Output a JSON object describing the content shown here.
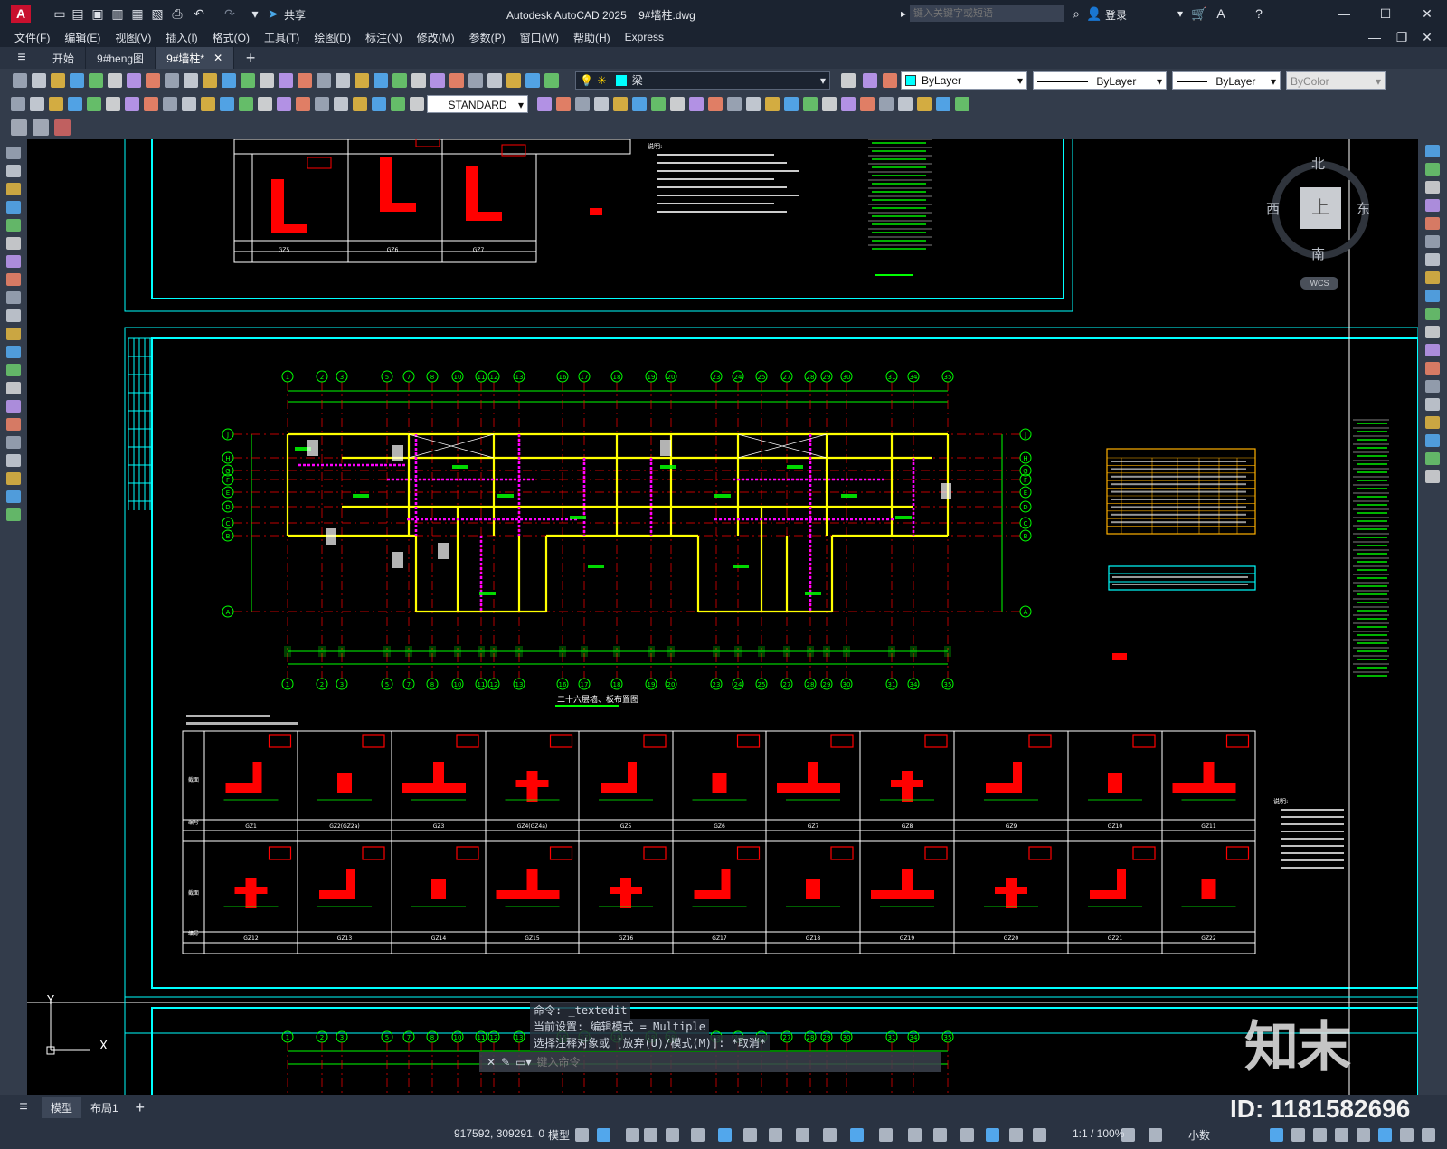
{
  "app": {
    "logo": "A",
    "title": "Autodesk AutoCAD 2025",
    "filename": "9#墙柱.dwg",
    "search_placeholder": "键入关键字或短语",
    "login": "登录",
    "share": "共享"
  },
  "menu": [
    "文件(F)",
    "编辑(E)",
    "视图(V)",
    "插入(I)",
    "格式(O)",
    "工具(T)",
    "绘图(D)",
    "标注(N)",
    "修改(M)",
    "参数(P)",
    "窗口(W)",
    "帮助(H)",
    "Express"
  ],
  "tabs": [
    {
      "label": "开始",
      "active": false
    },
    {
      "label": "9#heng图",
      "active": false
    },
    {
      "label": "9#墙柱*",
      "active": true
    }
  ],
  "toolbar": {
    "layer": "梁",
    "color": "ByLayer",
    "linetype": "ByLayer",
    "lineweight": "ByLayer",
    "plotstyle": "ByColor",
    "dimstyle": "STANDARD"
  },
  "viewcube": {
    "north": "北",
    "south": "南",
    "east": "东",
    "west": "西",
    "top": "上",
    "wcs": "WCS"
  },
  "drawing": {
    "plan_title": "二十六层墙、板布置图",
    "table_rows": [
      "截面",
      "编号",
      "标高"
    ],
    "column_ids_top": [
      "GZ1",
      "GZ2(GZ2a)",
      "GZ3",
      "GZ4(GZ4a)",
      "GZ5",
      "GZ6",
      "GZ7",
      "GZ8",
      "GZ9",
      "GZ10",
      "GZ11"
    ],
    "column_ids_bottom": [
      "GZ12",
      "GZ13",
      "GZ14",
      "GZ15",
      "GZ16",
      "GZ17",
      "GZ18",
      "GZ19",
      "GZ20",
      "GZ21",
      "GZ22"
    ],
    "upper_ids": [
      "GZ5",
      "GZ6",
      "GZ7"
    ],
    "notes_label": "说明:",
    "axis_top": [
      "1",
      "2",
      "3",
      "5",
      "7",
      "8",
      "10",
      "11",
      "12",
      "13",
      "16",
      "17",
      "18",
      "19",
      "20",
      "23",
      "24",
      "25",
      "27",
      "28",
      "29",
      "30",
      "31",
      "34",
      "35"
    ],
    "axis_left": [
      "J",
      "H",
      "G",
      "F",
      "E",
      "D",
      "C",
      "B",
      "A"
    ]
  },
  "command": {
    "line1": "命令: _textedit",
    "line2": "当前设置: 编辑模式 = Multiple",
    "line3": "选择注释对象或 [放弃(U)/模式(M)]: *取消*",
    "placeholder": "键入命令"
  },
  "layouts": {
    "model": "模型",
    "layout1": "布局1"
  },
  "status": {
    "coords": "917592, 309291, 0",
    "model": "模型",
    "scale": "1:1 / 100%",
    "units": "小数"
  },
  "watermark": {
    "brand": "知末",
    "id": "ID: 1181582696"
  },
  "colors": {
    "accent": "#0696d7",
    "cyan": "#00ffff",
    "green": "#00ff00",
    "red": "#ff0000",
    "magenta": "#ff00ff",
    "yellow": "#ffff00"
  }
}
